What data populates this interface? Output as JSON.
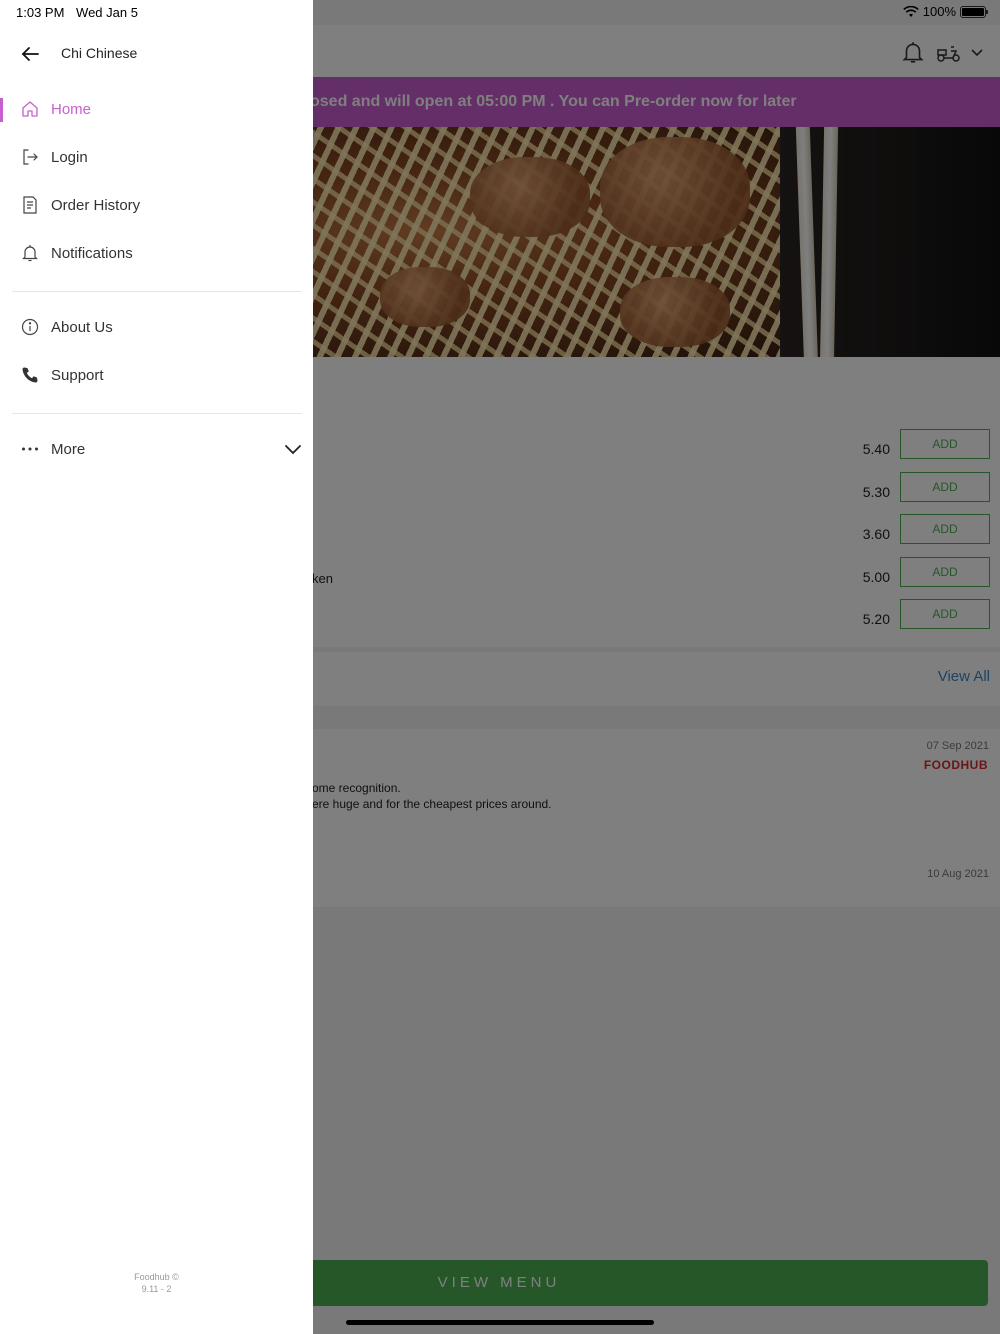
{
  "status_bar": {
    "time": "1:03 PM",
    "date": "Wed Jan 5",
    "battery": "100%",
    "battery_level": 1.0
  },
  "drawer": {
    "title": "Chi Chinese",
    "nav_items": [
      {
        "label": "Home",
        "icon": "home-icon",
        "active": true
      },
      {
        "label": "Login",
        "icon": "login-icon"
      },
      {
        "label": "Order History",
        "icon": "receipt-icon"
      },
      {
        "label": "Notifications",
        "icon": "bell-icon"
      }
    ],
    "info_items": [
      {
        "label": "About Us",
        "icon": "info-icon"
      },
      {
        "label": "Support",
        "icon": "phone-icon"
      }
    ],
    "more_label": "More",
    "footer_brand": "Foodhub ©",
    "footer_version": "9.11 - 2"
  },
  "app": {
    "banner_text": "osed and will open at 05:00 PM . You can Pre-order now for later",
    "menu_items": [
      {
        "name": "",
        "price": "5.40",
        "add_label": "ADD"
      },
      {
        "name": "",
        "price": "5.30",
        "add_label": "ADD"
      },
      {
        "name": "",
        "price": "3.60",
        "add_label": "ADD"
      },
      {
        "name": "ken",
        "price": "5.00",
        "add_label": "ADD"
      },
      {
        "name": "",
        "price": "5.20",
        "add_label": "ADD"
      }
    ],
    "view_all_label": "View All",
    "reviews": [
      {
        "date": "07 Sep 2021",
        "source": "FOODHUB",
        "lines": [
          "ome recognition.",
          "ere huge and for the cheapest prices around."
        ]
      },
      {
        "date": "10 Aug 2021"
      }
    ],
    "view_menu_label": "VIEW MENU"
  },
  "colors": {
    "accent": "#c85fd0",
    "primary_green": "#4caf50",
    "link_blue": "#3a86c8",
    "brand_red": "#d42c2c"
  }
}
